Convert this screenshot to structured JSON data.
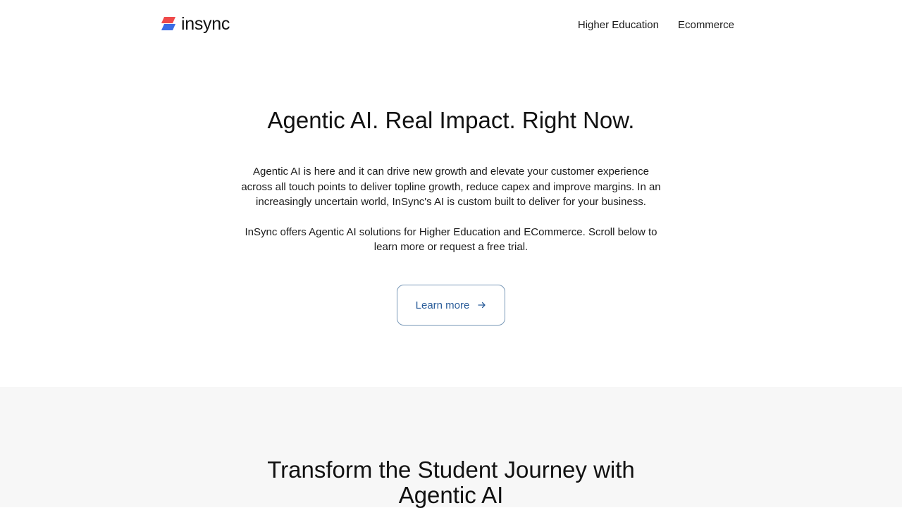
{
  "brand": {
    "name": "insync",
    "colors": {
      "mark_top": "#ef4a4a",
      "mark_bottom": "#3b6de6"
    }
  },
  "nav": {
    "items": [
      {
        "label": "Higher Education"
      },
      {
        "label": "Ecommerce"
      }
    ]
  },
  "hero": {
    "title": "Agentic AI. Real Impact. Right Now.",
    "paragraph_1": "Agentic AI is here and it can drive new growth and elevate your customer experience across all touch points to deliver topline growth, reduce capex and improve margins. In an increasingly uncertain world, InSync's AI is custom built to deliver for your business.",
    "paragraph_2": "InSync offers Agentic AI solutions for Higher Education and ECommerce. Scroll below to learn more or request a free trial.",
    "cta_label": "Learn more",
    "cta_icon": "arrow-right-icon",
    "cta_color": "#2b5d9a"
  },
  "section2": {
    "title": "Transform the Student Journey with Agentic AI",
    "background": "#f7f7f7"
  }
}
